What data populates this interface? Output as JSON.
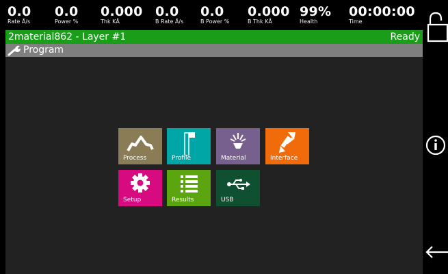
{
  "stats": [
    {
      "value": "0.0",
      "label": "Rate Å/s"
    },
    {
      "value": "0.0",
      "label": "Power %"
    },
    {
      "value": "0.000",
      "label": "Thk KÅ"
    },
    {
      "value": "0.0",
      "label": "B Rate Å/s"
    },
    {
      "value": "0.0",
      "label": "B Power %"
    },
    {
      "value": "0.000",
      "label": "B Thk KÅ"
    },
    {
      "value": "99%",
      "label": "Health"
    },
    {
      "value": "00:00:00",
      "label": "Time"
    }
  ],
  "status": {
    "name": "2material862 - Layer #1",
    "state": "Ready"
  },
  "page": {
    "title": "Program"
  },
  "tiles": [
    {
      "label": "Process",
      "color": "#8a7c54",
      "icon": "process-icon"
    },
    {
      "label": "Profile",
      "color": "#00a5a5",
      "icon": "profile-icon"
    },
    {
      "label": "Material",
      "color": "#77608e",
      "icon": "material-icon"
    },
    {
      "label": "Interface",
      "color": "#f26b0a",
      "icon": "interface-icon"
    },
    {
      "label": "Setup",
      "color": "#d80a80",
      "icon": "setup-icon"
    },
    {
      "label": "Results",
      "color": "#5aa510",
      "icon": "results-icon"
    },
    {
      "label": "USB",
      "color": "#0f5030",
      "icon": "usb-icon"
    }
  ],
  "rail": {
    "icons": [
      "lock-icon",
      "info-icon",
      "back-arrow-icon"
    ]
  }
}
